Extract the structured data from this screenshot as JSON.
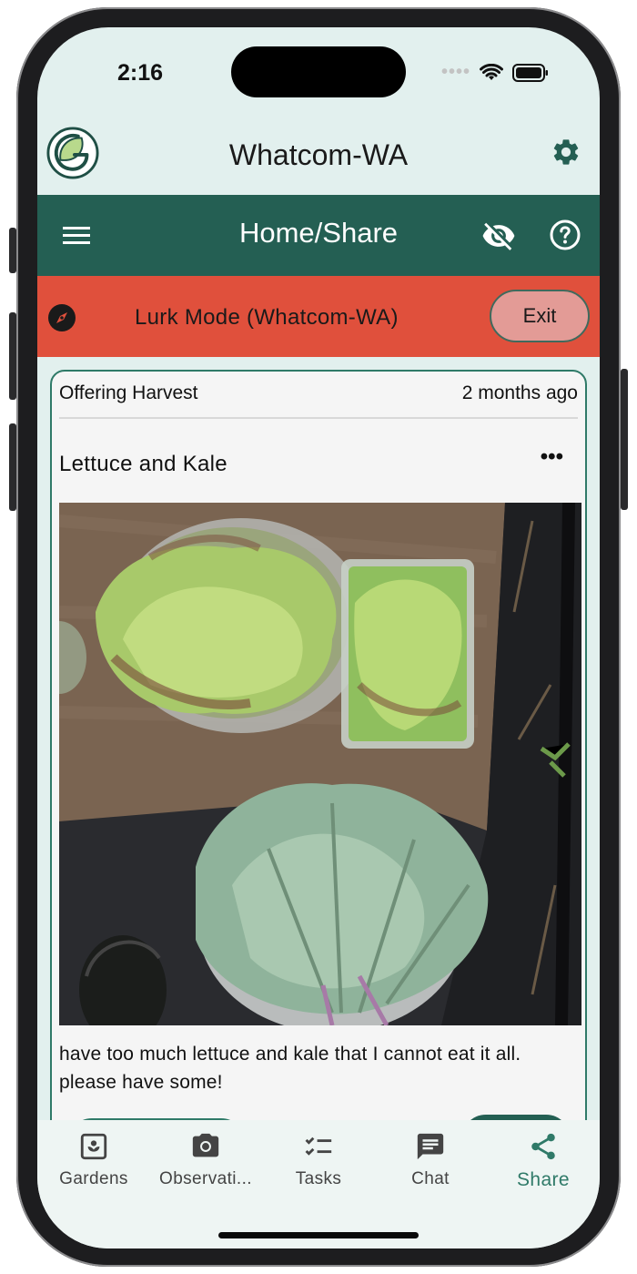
{
  "status": {
    "time": "2:16"
  },
  "header": {
    "garden_name": "Whatcom-WA",
    "logo_icon": "gardenbook-logo",
    "settings_icon": "gear-icon"
  },
  "nav": {
    "title": "Home/Share",
    "menu_icon": "hamburger-icon",
    "visibility_icon": "eye-off-icon",
    "help_icon": "help-circle-icon"
  },
  "lurk": {
    "text": "Lurk Mode (Whatcom-WA)",
    "exit_label": "Exit",
    "icon": "compass-icon"
  },
  "post": {
    "type": "Offering Harvest",
    "time_ago": "2 months ago",
    "title": "Lettuce and Kale",
    "more_label": "•••",
    "description": "have too much lettuce and kale that I cannot eat it all. please have some!",
    "image": "photo of harvested lettuce and kale in bowls"
  },
  "tabs": [
    {
      "label": "Gardens",
      "icon": "garden-icon",
      "active": false
    },
    {
      "label": "Observati...",
      "icon": "camera-icon",
      "active": false
    },
    {
      "label": "Tasks",
      "icon": "checklist-icon",
      "active": false
    },
    {
      "label": "Chat",
      "icon": "chat-icon",
      "active": false
    },
    {
      "label": "Share",
      "icon": "share-icon",
      "active": true
    }
  ],
  "colors": {
    "primary": "#245f53",
    "lurk": "#e0503c",
    "exit_button": "#e39b96",
    "background": "#e2f0ee",
    "active_tab": "#2f7a68"
  }
}
